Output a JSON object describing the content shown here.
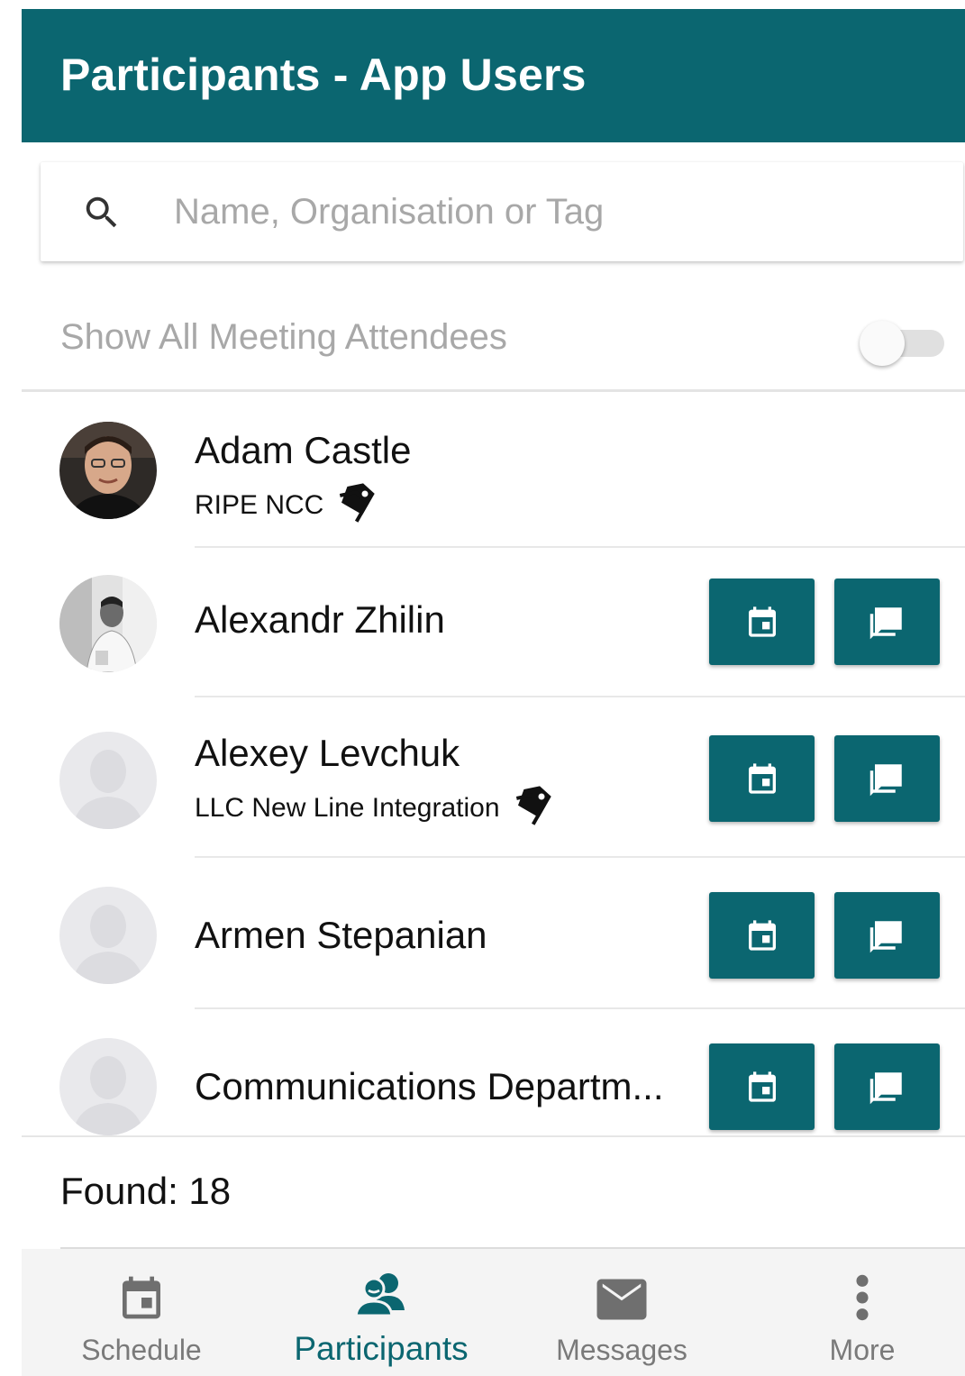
{
  "header": {
    "title": "Participants - App Users"
  },
  "search": {
    "placeholder": "Name, Organisation or Tag",
    "value": ""
  },
  "filter": {
    "label": "Show All Meeting Attendees",
    "enabled": false
  },
  "participants": [
    {
      "name": "Adam Castle",
      "organisation": "RIPE NCC",
      "has_tag": true,
      "avatar": "photo",
      "actions": false
    },
    {
      "name": "Alexandr Zhilin",
      "organisation": "",
      "has_tag": false,
      "avatar": "photo",
      "actions": true
    },
    {
      "name": "Alexey Levchuk",
      "organisation": "LLC New Line Integration",
      "has_tag": true,
      "avatar": "placeholder",
      "actions": true
    },
    {
      "name": "Armen Stepanian",
      "organisation": "",
      "has_tag": false,
      "avatar": "placeholder",
      "actions": true
    },
    {
      "name": "Communications Departm...",
      "organisation": "",
      "has_tag": false,
      "avatar": "placeholder",
      "actions": true
    }
  ],
  "footer": {
    "found_text": "Found: 18"
  },
  "nav": {
    "items": [
      {
        "label": "Schedule",
        "icon": "calendar-icon",
        "active": false
      },
      {
        "label": "Participants",
        "icon": "people-icon",
        "active": true
      },
      {
        "label": "Messages",
        "icon": "envelope-icon",
        "active": false
      },
      {
        "label": "More",
        "icon": "more-vertical-icon",
        "active": false
      }
    ]
  },
  "colors": {
    "primary": "#0b6670",
    "muted": "#a8a8a8",
    "nav_inactive": "#7a7a7a"
  }
}
